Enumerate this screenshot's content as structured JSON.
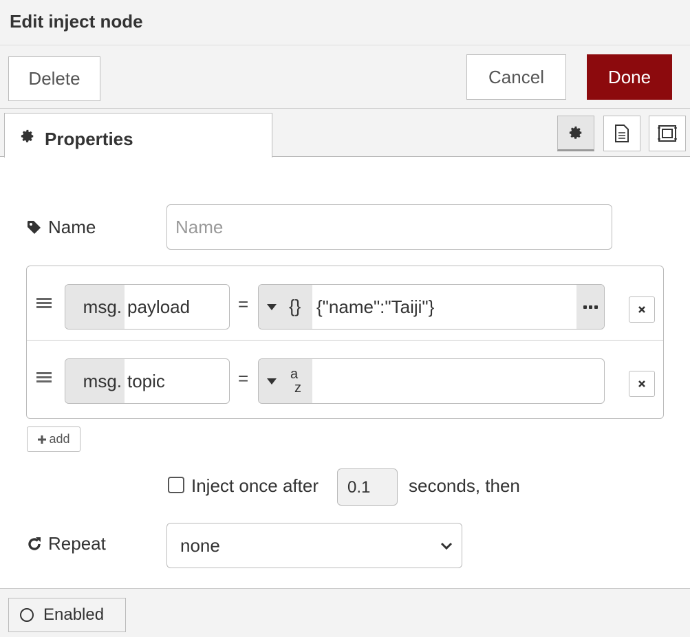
{
  "header": {
    "title": "Edit inject node"
  },
  "toolbar": {
    "delete_label": "Delete",
    "cancel_label": "Cancel",
    "done_label": "Done"
  },
  "tabs": [
    {
      "label": "Properties",
      "icon": "gear-icon",
      "active": true
    }
  ],
  "tab_tools": [
    "gear-icon",
    "document-icon",
    "frame-icon"
  ],
  "form": {
    "name_label": "Name",
    "name_placeholder": "Name",
    "name_value": "",
    "properties": [
      {
        "prefix": "msg.",
        "name": "payload",
        "equals": "=",
        "type_icon": "{}",
        "value": "{\"name\":\"Taiji\"}"
      },
      {
        "prefix": "msg.",
        "name": "topic",
        "equals": "=",
        "type_icon_top": "a",
        "type_icon_bottom": "z",
        "value": ""
      }
    ],
    "add_label": "add",
    "inject_once_label": "Inject once after",
    "inject_once_checked": false,
    "inject_delay": "0.1",
    "inject_then_label": "seconds, then",
    "repeat_label": "Repeat",
    "repeat_value": "none"
  },
  "footer": {
    "enabled_label": "Enabled"
  },
  "colors": {
    "done": "#8c0a0d",
    "panel_bg": "#f3f3f3",
    "border": "#bbbbbb"
  }
}
